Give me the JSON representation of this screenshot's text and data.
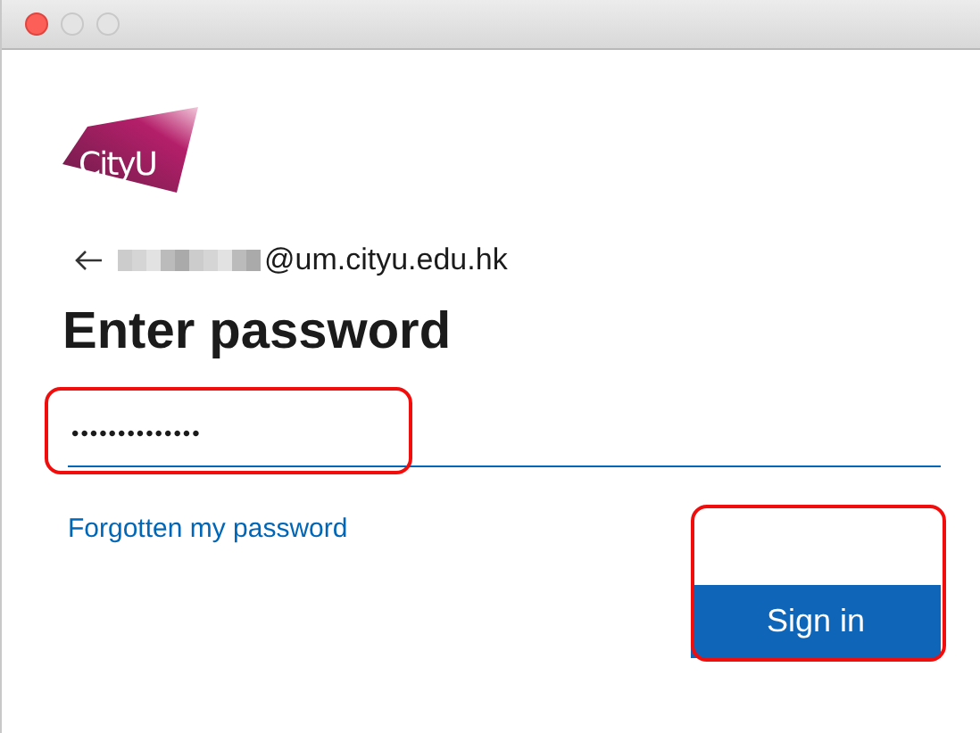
{
  "logo": {
    "text": "CityU"
  },
  "account": {
    "email_suffix": "@um.cityu.edu.hk",
    "redacted": true
  },
  "heading": "Enter password",
  "password": {
    "value": "••••••••••••••",
    "highlighted": true
  },
  "forgot_link": "Forgotten my password",
  "sign_in": {
    "label": "Sign in",
    "highlighted": true
  }
}
